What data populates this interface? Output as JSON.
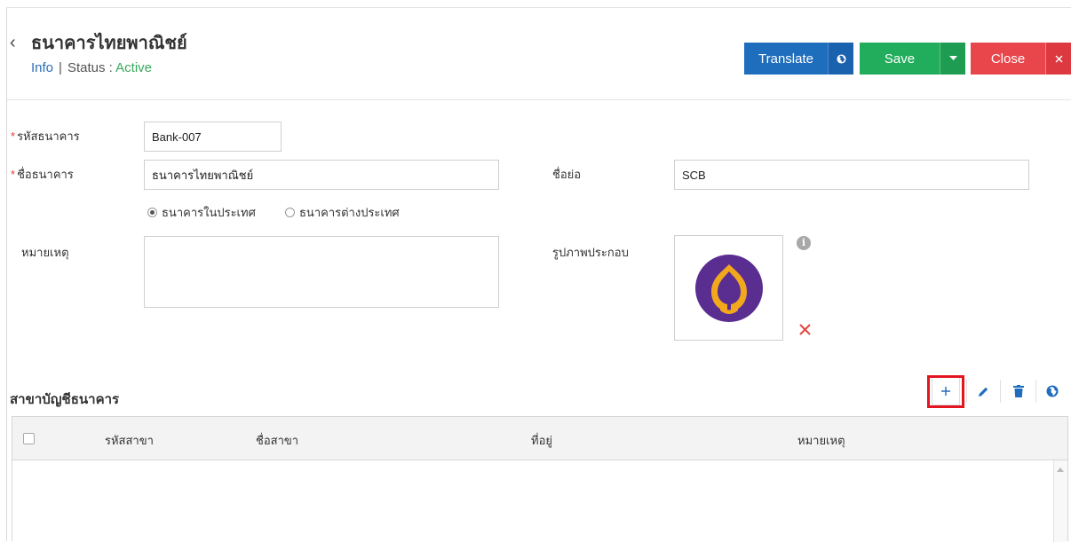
{
  "header": {
    "title": "ธนาคารไทยพาณิชย์",
    "info_link": "Info",
    "separator": "|",
    "status_label": "Status :",
    "status_value": "Active"
  },
  "toolbar": {
    "translate_label": "Translate",
    "save_label": "Save",
    "close_label": "Close"
  },
  "form": {
    "bank_code_label": "รหัสธนาคาร",
    "bank_code_value": "Bank-007",
    "bank_name_label": "ชื่อธนาคาร",
    "bank_name_value": "ธนาคารไทยพาณิชย์",
    "short_name_label": "ชื่อย่อ",
    "short_name_value": "SCB",
    "radio_domestic": "ธนาคารในประเทศ",
    "radio_foreign": "ธนาคารต่างประเทศ",
    "radio_selected": "domestic",
    "remark_label": "หมายเหตุ",
    "remark_value": "",
    "image_label": "รูปภาพประกอบ"
  },
  "branches": {
    "section_title": "สาขาบัญชีธนาคาร",
    "columns": [
      "รหัสสาขา",
      "ชื่อสาขา",
      "ที่อยู่",
      "หมายเหตุ"
    ],
    "rows": []
  },
  "colors": {
    "translate": "#1f6dbd",
    "save": "#21ad5b",
    "close": "#e8464b",
    "status_active": "#3aa85c",
    "highlight": "#e2161e",
    "logo_purple": "#5a2d91",
    "logo_gold": "#f2a81d"
  },
  "icons": {
    "back": "chevron-left-icon",
    "translate": "globe-icon",
    "save_menu": "caret-down-icon",
    "close": "close-icon",
    "info": "info-icon",
    "remove_image": "remove-icon",
    "add": "plus-icon",
    "edit": "pencil-icon",
    "delete": "trash-icon",
    "globe": "globe-icon"
  }
}
